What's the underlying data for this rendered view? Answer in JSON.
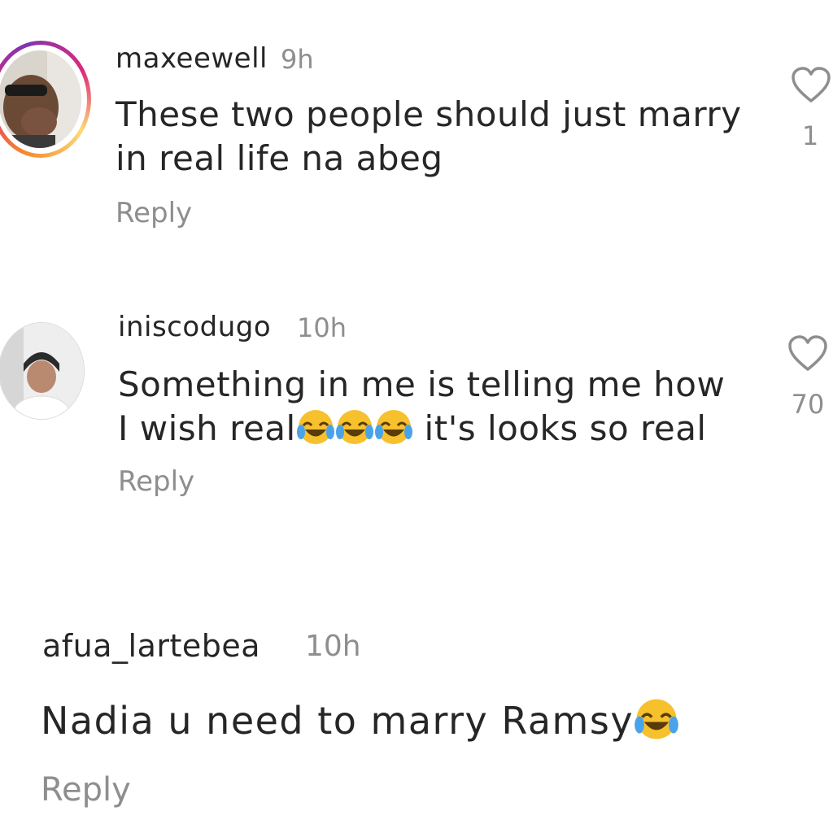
{
  "comments": [
    {
      "username": "maxeewell",
      "time": "9h",
      "text": "These two people should just marry in real life na abeg",
      "reply_label": "Reply",
      "likes": "1",
      "avatar_icon": "user-photo-with-story-ring"
    },
    {
      "username": "iniscodugo",
      "time": "10h",
      "text_before": "Something in me is telling me how I wish real",
      "text_after": " it's looks so real",
      "emoji": "face-with-tears-of-joy",
      "reply_label": "Reply",
      "likes": "70",
      "avatar_icon": "user-photo"
    },
    {
      "username": "afua_lartebea",
      "time": "10h",
      "text_before": "Nadia u need to marry Ramsy",
      "emoji": "face-with-tears-of-joy",
      "reply_label": "Reply"
    }
  ],
  "colors": {
    "text": "#262626",
    "secondary": "#8e8e8e",
    "story_ring_start": "#f58529",
    "story_ring_mid": "#dd2a7b"
  }
}
